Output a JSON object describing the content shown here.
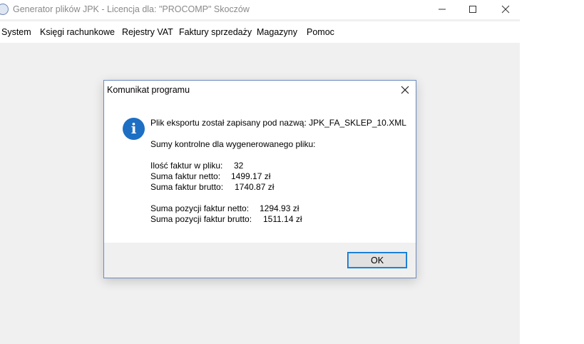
{
  "window": {
    "title": "Generator plików JPK - Licencja dla: \"PROCOMP\" Skoczów",
    "app_icon": "jpk-app-icon",
    "buttons": [
      "minimize-icon",
      "maximize-icon",
      "close-icon"
    ]
  },
  "menu": {
    "items": [
      {
        "label": "System"
      },
      {
        "label": "Księgi rachunkowe"
      },
      {
        "label": "Rejestry VAT"
      },
      {
        "label": "Faktury sprzedaży"
      },
      {
        "label": "Magazyny"
      },
      {
        "label": "Pomoc"
      }
    ]
  },
  "dialog": {
    "title": "Komunikat programu",
    "icon": "info-icon",
    "icon_glyph": "i",
    "line1": "Plik eksportu został zapisany pod nazwą: JPK_FA_SKLEP_10.XML",
    "line2": "Sumy kontrolne dla wygenerowanego pliku:",
    "rows": [
      {
        "label": "Ilość faktur w pliku:",
        "value": "32"
      },
      {
        "label": "Suma faktur netto:",
        "value": "1499.17 zł"
      },
      {
        "label": "Suma faktur brutto:",
        "value": "1740.87 zł"
      },
      {
        "label": "Suma pozycji faktur netto:",
        "value": "1294.93 zł"
      },
      {
        "label": "Suma pozycji faktur brutto:",
        "value": "1511.14 zł"
      }
    ],
    "ok_label": "OK"
  },
  "colors": {
    "accent": "#0078d7",
    "info_icon": "#1d6fc4",
    "dialog_border": "#6b8bbf",
    "window_bg": "#f0f0f0"
  }
}
